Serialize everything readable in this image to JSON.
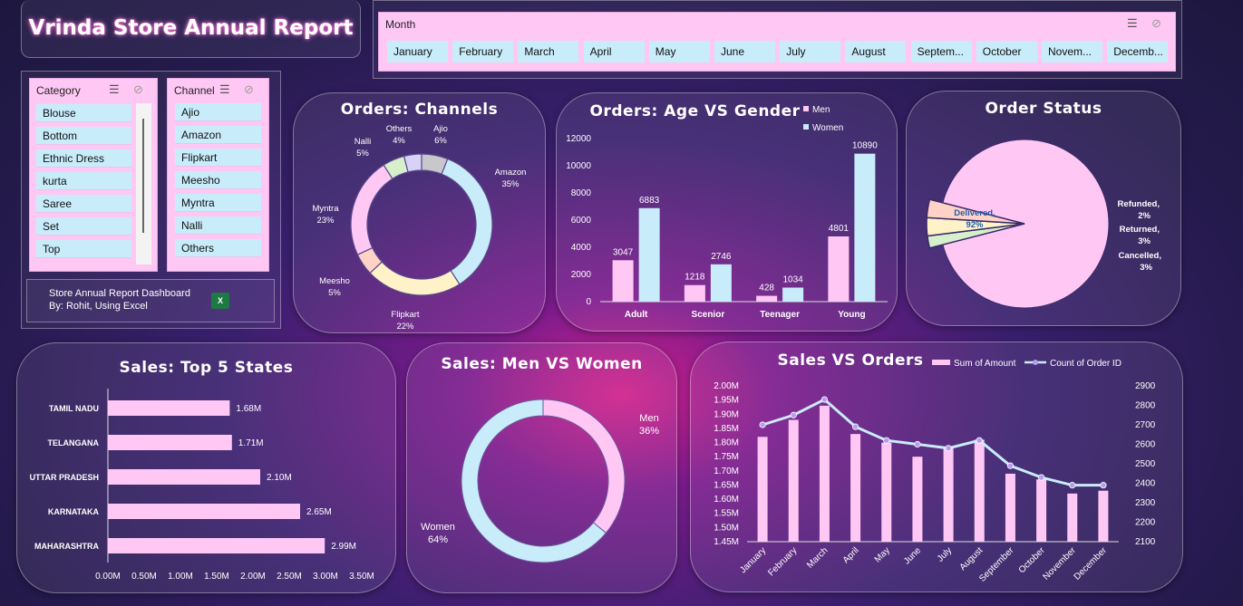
{
  "header": {
    "title": "Vrinda Store Annual Report"
  },
  "month_slicer": {
    "label": "Month",
    "months": [
      "January",
      "February",
      "March",
      "April",
      "May",
      "June",
      "July",
      "August",
      "Septem...",
      "October",
      "Novem...",
      "Decemb..."
    ]
  },
  "category_slicer": {
    "label": "Category",
    "items": [
      "Blouse",
      "Bottom",
      "Ethnic Dress",
      "kurta",
      "Saree",
      "Set",
      "Top"
    ]
  },
  "channel_slicer": {
    "label": "Channel",
    "items": [
      "Ajio",
      "Amazon",
      "Flipkart",
      "Meesho",
      "Myntra",
      "Nalli",
      "Others"
    ]
  },
  "footer": {
    "line1": "Store Annual Report Dashboard",
    "line2": "By: Rohit, Using Excel",
    "excel_icon": "excel-icon"
  },
  "colors": {
    "pink": "#ffc8f4",
    "blue": "#c9ecfb",
    "yellow": "#fff2c8",
    "green": "#d6f0cc",
    "peach": "#ffd2c8",
    "lavender": "#d8d2f8",
    "grey": "#c8c8cc"
  },
  "chart_data": [
    {
      "id": "channels",
      "type": "pie",
      "title": "Orders: Channels",
      "slices": [
        {
          "name": "Ajio",
          "value": 6,
          "label": "6%",
          "color": "#c8c8cc"
        },
        {
          "name": "Amazon",
          "value": 35,
          "label": "35%",
          "color": "#c9ecfb"
        },
        {
          "name": "Flipkart",
          "value": 22,
          "label": "22%",
          "color": "#fff2c8"
        },
        {
          "name": "Meesho",
          "value": 5,
          "label": "5%",
          "color": "#ffd2c8"
        },
        {
          "name": "Myntra",
          "value": 23,
          "label": "23%",
          "color": "#ffc8f4"
        },
        {
          "name": "Nalli",
          "value": 5,
          "label": "5%",
          "color": "#d6f0cc"
        },
        {
          "name": "Others",
          "value": 4,
          "label": "4%",
          "color": "#d8d2f8"
        }
      ]
    },
    {
      "id": "age_gender",
      "type": "bar",
      "title": "Orders: Age VS Gender",
      "categories": [
        "Adult",
        "Scenior",
        "Teenager",
        "Young"
      ],
      "series": [
        {
          "name": "Men",
          "values": [
            3047,
            1218,
            428,
            4801
          ],
          "color": "#ffc8f4"
        },
        {
          "name": "Women",
          "values": [
            6883,
            2746,
            1034,
            10890
          ],
          "color": "#c9ecfb"
        }
      ],
      "yticks": [
        "0",
        "2000",
        "4000",
        "6000",
        "8000",
        "10000",
        "12000"
      ],
      "ylim": [
        0,
        12000
      ],
      "legend": "top-right"
    },
    {
      "id": "order_status",
      "type": "pie",
      "title": "Order Status",
      "slices": [
        {
          "name": "Delivered",
          "value": 92,
          "label": "92%",
          "color": "#ffc8f4"
        },
        {
          "name": "Refunded",
          "value": 2,
          "label": "2%",
          "color": "#d6f0cc"
        },
        {
          "name": "Returned",
          "value": 3,
          "label": "3%",
          "color": "#fff2c8"
        },
        {
          "name": "Cancelled",
          "value": 3,
          "label": "3%",
          "color": "#ffd2c8"
        }
      ]
    },
    {
      "id": "top_states",
      "type": "bar",
      "title": "Sales: Top 5 States",
      "orientation": "horizontal",
      "categories": [
        "TAMIL NADU",
        "TELANGANA",
        "UTTAR PRADESH",
        "KARNATAKA",
        "MAHARASHTRA"
      ],
      "values": [
        1.68,
        1.71,
        2.1,
        2.65,
        2.99
      ],
      "value_labels": [
        "1.68M",
        "1.71M",
        "2.10M",
        "2.65M",
        "2.99M"
      ],
      "xticks": [
        "0.00M",
        "0.50M",
        "1.00M",
        "1.50M",
        "2.00M",
        "2.50M",
        "3.00M",
        "3.50M"
      ],
      "xlim": [
        0,
        3.5
      ]
    },
    {
      "id": "men_women",
      "type": "pie",
      "title": "Sales: Men VS Women",
      "slices": [
        {
          "name": "Men",
          "value": 36,
          "label": "36%",
          "color": "#ffc8f4"
        },
        {
          "name": "Women",
          "value": 64,
          "label": "64%",
          "color": "#c9ecfb"
        }
      ]
    },
    {
      "id": "sales_orders",
      "type": "bar",
      "title": "Sales VS Orders",
      "categories": [
        "January",
        "February",
        "March",
        "April",
        "May",
        "June",
        "July",
        "August",
        "September",
        "October",
        "November",
        "December"
      ],
      "series": [
        {
          "name": "Sum of Amount",
          "type": "bar",
          "axis": "left",
          "values": [
            1.82,
            1.88,
            1.93,
            1.83,
            1.8,
            1.75,
            1.78,
            1.81,
            1.69,
            1.67,
            1.62,
            1.63
          ],
          "color": "#ffc8f4"
        },
        {
          "name": "Count of Order ID",
          "type": "line",
          "axis": "right",
          "values": [
            2700,
            2750,
            2830,
            2690,
            2620,
            2600,
            2580,
            2620,
            2490,
            2430,
            2390,
            2390
          ],
          "color": "#c9ecfb"
        }
      ],
      "y_left_ticks": [
        "1.45M",
        "1.50M",
        "1.55M",
        "1.60M",
        "1.65M",
        "1.70M",
        "1.75M",
        "1.80M",
        "1.85M",
        "1.90M",
        "1.95M",
        "2.00M"
      ],
      "y_left_lim": [
        1.45,
        2.0
      ],
      "y_right_ticks": [
        "2100",
        "2200",
        "2300",
        "2400",
        "2500",
        "2600",
        "2700",
        "2800",
        "2900"
      ],
      "y_right_lim": [
        2100,
        2900
      ],
      "legend": "top-right"
    }
  ]
}
